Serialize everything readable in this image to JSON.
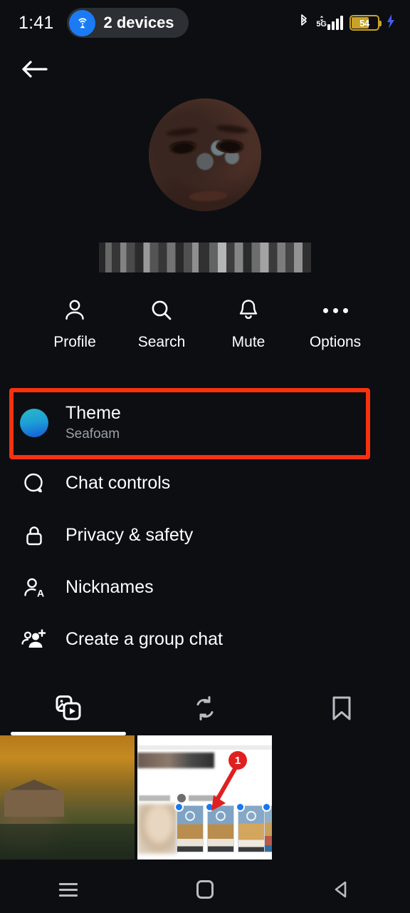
{
  "status_bar": {
    "time": "1:41",
    "devices_pill_label": "2 devices",
    "devices_icon": "hotspot-icon",
    "bluetooth_icon": "bluetooth-icon",
    "network_type": "5G",
    "signal_icon": "signal-bars-icon",
    "battery_percent": "54",
    "charging_icon": "lightning-bolt-icon",
    "accent_blue": "#1a7bf5",
    "battery_color": "#c9a227"
  },
  "nav": {
    "back_icon": "arrow-left-icon"
  },
  "profile": {
    "avatar_alt": "contact-profile-photo",
    "name_redacted": true,
    "name": ""
  },
  "actions": [
    {
      "label": "Profile",
      "icon": "person-icon"
    },
    {
      "label": "Search",
      "icon": "search-icon"
    },
    {
      "label": "Mute",
      "icon": "bell-icon"
    },
    {
      "label": "Options",
      "icon": "more-horizontal-icon"
    }
  ],
  "menu": {
    "theme": {
      "title": "Theme",
      "subtitle": "Seafoam",
      "swatch_top_color": "#2ab8c9",
      "swatch_bottom_color": "#1559d6",
      "highlighted": true,
      "highlight_color": "#f9310f"
    },
    "items": [
      {
        "title": "Chat controls",
        "icon": "chat-bubble-icon"
      },
      {
        "title": "Privacy & safety",
        "icon": "lock-icon"
      },
      {
        "title": "Nicknames",
        "icon": "person-letter-a-icon"
      },
      {
        "title": "Create a group chat",
        "icon": "people-add-icon"
      }
    ]
  },
  "tabs": [
    {
      "icon": "media-photos-video-icon",
      "active": true
    },
    {
      "icon": "shared-repeat-icon",
      "active": false
    },
    {
      "icon": "bookmark-icon",
      "active": false
    }
  ],
  "media": {
    "thumbnails": [
      {
        "name": "autumn-lake-cabin-photo",
        "type": "photo"
      },
      {
        "name": "annotated-screenshot",
        "type": "screenshot",
        "annotation_number": "1"
      }
    ]
  },
  "system_nav": {
    "recents": "recents-icon",
    "home": "home-icon",
    "back": "back-triangle-icon"
  }
}
